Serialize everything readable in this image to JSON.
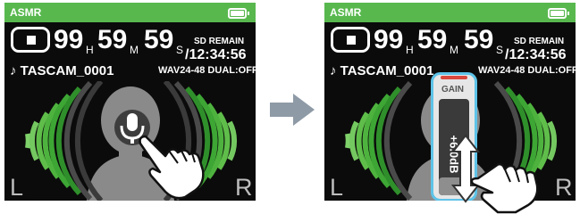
{
  "screens": [
    {
      "title": "ASMR",
      "time_hours": "99",
      "time_minutes": "59",
      "time_seconds": "59",
      "unit_h": "H",
      "unit_m": "M",
      "unit_s": "S",
      "remain_label": "SD REMAIN",
      "remain_time": "/12:34:56",
      "file_name": "♪ TASCAM_0001",
      "format": "WAV24-48 DUAL:OFF",
      "left_label": "L",
      "right_label": "R"
    },
    {
      "title": "ASMR",
      "time_hours": "99",
      "time_minutes": "59",
      "time_seconds": "59",
      "unit_h": "H",
      "unit_m": "M",
      "unit_s": "S",
      "remain_label": "SD REMAIN",
      "remain_time": "/12:34:56",
      "file_name": "♪ TASCAM_0001",
      "format": "WAV24-48 DUAL:OFF",
      "left_label": "L",
      "right_label": "R",
      "gain": {
        "label": "GAIN",
        "value": "+6.0dB"
      }
    }
  ],
  "colors": {
    "accent": "#58b84e",
    "gain_border": "#5ec3e8",
    "gain_indicator": "#d9473d"
  },
  "icons": [
    "stop-icon",
    "battery-icon",
    "microphone-icon",
    "finger-tap-icon",
    "arrow-right-icon",
    "swipe-up-down-icon"
  ]
}
